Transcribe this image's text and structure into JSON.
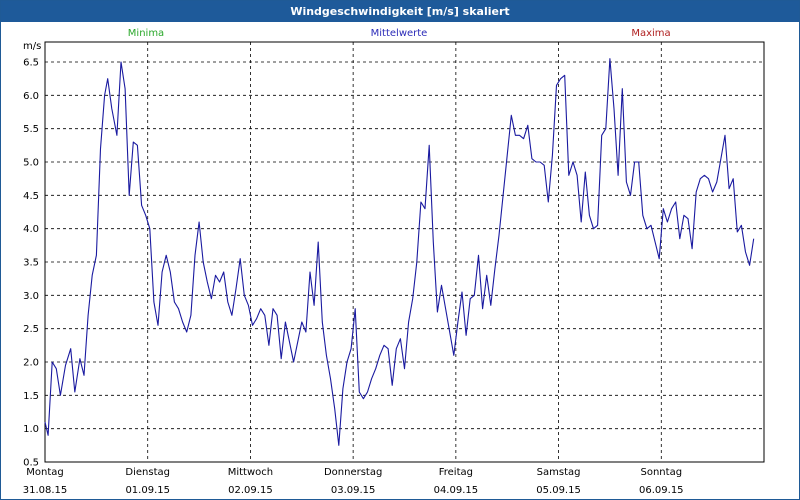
{
  "window": {
    "title": "Windgeschwindigkeit [m/s] skaliert"
  },
  "legend": {
    "min_label": "Minima",
    "mean_label": "Mittelwerte",
    "max_label": "Maxima",
    "min_color": "#2aa82a",
    "mean_color": "#2b2bb8",
    "max_color": "#b02020"
  },
  "chart_data": {
    "type": "line",
    "ylabel": "m/s",
    "ylim": [
      0.5,
      6.8
    ],
    "yticks": [
      "0.5",
      "1.0",
      "1.5",
      "2.0",
      "2.5",
      "3.0",
      "3.5",
      "4.0",
      "4.5",
      "5.0",
      "5.5",
      "6.0",
      "6.5"
    ],
    "xlim": [
      0,
      7
    ],
    "grid": true,
    "x_categories": [
      {
        "day": "Montag",
        "date": "31.08.15"
      },
      {
        "day": "Dienstag",
        "date": "01.09.15"
      },
      {
        "day": "Mittwoch",
        "date": "02.09.15"
      },
      {
        "day": "Donnerstag",
        "date": "03.09.15"
      },
      {
        "day": "Freitag",
        "date": "04.09.15"
      },
      {
        "day": "Samstag",
        "date": "05.09.15"
      },
      {
        "day": "Sonntag",
        "date": "06.09.15"
      }
    ],
    "series": [
      {
        "name": "Mittelwerte",
        "color": "#1a1aa0",
        "points": [
          [
            0.0,
            1.1
          ],
          [
            0.03,
            0.9
          ],
          [
            0.07,
            2.0
          ],
          [
            0.11,
            1.9
          ],
          [
            0.15,
            1.5
          ],
          [
            0.2,
            1.95
          ],
          [
            0.25,
            2.2
          ],
          [
            0.29,
            1.55
          ],
          [
            0.34,
            2.05
          ],
          [
            0.38,
            1.8
          ],
          [
            0.42,
            2.7
          ],
          [
            0.46,
            3.3
          ],
          [
            0.5,
            3.6
          ],
          [
            0.54,
            5.2
          ],
          [
            0.58,
            6.0
          ],
          [
            0.61,
            6.25
          ],
          [
            0.65,
            5.8
          ],
          [
            0.7,
            5.4
          ],
          [
            0.74,
            6.5
          ],
          [
            0.78,
            6.1
          ],
          [
            0.82,
            4.5
          ],
          [
            0.86,
            5.3
          ],
          [
            0.9,
            5.25
          ],
          [
            0.94,
            4.35
          ],
          [
            0.98,
            4.2
          ],
          [
            1.02,
            4.0
          ],
          [
            1.06,
            2.9
          ],
          [
            1.1,
            2.55
          ],
          [
            1.14,
            3.35
          ],
          [
            1.18,
            3.6
          ],
          [
            1.22,
            3.35
          ],
          [
            1.26,
            2.9
          ],
          [
            1.3,
            2.8
          ],
          [
            1.34,
            2.6
          ],
          [
            1.38,
            2.45
          ],
          [
            1.42,
            2.7
          ],
          [
            1.46,
            3.6
          ],
          [
            1.5,
            4.1
          ],
          [
            1.54,
            3.5
          ],
          [
            1.58,
            3.2
          ],
          [
            1.62,
            2.95
          ],
          [
            1.66,
            3.3
          ],
          [
            1.7,
            3.2
          ],
          [
            1.74,
            3.35
          ],
          [
            1.78,
            2.9
          ],
          [
            1.82,
            2.7
          ],
          [
            1.86,
            3.1
          ],
          [
            1.9,
            3.55
          ],
          [
            1.94,
            3.0
          ],
          [
            1.98,
            2.85
          ],
          [
            2.02,
            2.55
          ],
          [
            2.06,
            2.65
          ],
          [
            2.1,
            2.8
          ],
          [
            2.14,
            2.7
          ],
          [
            2.18,
            2.25
          ],
          [
            2.22,
            2.8
          ],
          [
            2.26,
            2.7
          ],
          [
            2.3,
            2.05
          ],
          [
            2.34,
            2.6
          ],
          [
            2.38,
            2.3
          ],
          [
            2.42,
            2.0
          ],
          [
            2.46,
            2.3
          ],
          [
            2.5,
            2.6
          ],
          [
            2.54,
            2.45
          ],
          [
            2.58,
            3.35
          ],
          [
            2.62,
            2.85
          ],
          [
            2.66,
            3.8
          ],
          [
            2.7,
            2.6
          ],
          [
            2.74,
            2.1
          ],
          [
            2.78,
            1.75
          ],
          [
            2.82,
            1.3
          ],
          [
            2.86,
            0.75
          ],
          [
            2.9,
            1.6
          ],
          [
            2.94,
            2.0
          ],
          [
            2.98,
            2.2
          ],
          [
            3.02,
            2.8
          ],
          [
            3.06,
            1.55
          ],
          [
            3.1,
            1.45
          ],
          [
            3.14,
            1.55
          ],
          [
            3.18,
            1.75
          ],
          [
            3.22,
            1.9
          ],
          [
            3.26,
            2.1
          ],
          [
            3.3,
            2.25
          ],
          [
            3.34,
            2.2
          ],
          [
            3.38,
            1.65
          ],
          [
            3.42,
            2.2
          ],
          [
            3.46,
            2.35
          ],
          [
            3.5,
            1.9
          ],
          [
            3.54,
            2.6
          ],
          [
            3.58,
            2.95
          ],
          [
            3.62,
            3.5
          ],
          [
            3.66,
            4.4
          ],
          [
            3.7,
            4.3
          ],
          [
            3.74,
            5.25
          ],
          [
            3.78,
            3.8
          ],
          [
            3.82,
            2.75
          ],
          [
            3.86,
            3.15
          ],
          [
            3.9,
            2.8
          ],
          [
            3.94,
            2.45
          ],
          [
            3.98,
            2.1
          ],
          [
            4.02,
            2.6
          ],
          [
            4.06,
            3.05
          ],
          [
            4.1,
            2.4
          ],
          [
            4.14,
            2.95
          ],
          [
            4.18,
            3.0
          ],
          [
            4.22,
            3.6
          ],
          [
            4.26,
            2.8
          ],
          [
            4.3,
            3.3
          ],
          [
            4.34,
            2.85
          ],
          [
            4.38,
            3.4
          ],
          [
            4.42,
            3.9
          ],
          [
            4.46,
            4.5
          ],
          [
            4.5,
            5.1
          ],
          [
            4.54,
            5.7
          ],
          [
            4.58,
            5.4
          ],
          [
            4.62,
            5.4
          ],
          [
            4.66,
            5.35
          ],
          [
            4.7,
            5.55
          ],
          [
            4.74,
            5.05
          ],
          [
            4.78,
            5.0
          ],
          [
            4.82,
            5.0
          ],
          [
            4.86,
            4.95
          ],
          [
            4.9,
            4.4
          ],
          [
            4.94,
            5.1
          ],
          [
            4.98,
            6.15
          ],
          [
            5.02,
            6.25
          ],
          [
            5.06,
            6.3
          ],
          [
            5.1,
            4.8
          ],
          [
            5.14,
            5.0
          ],
          [
            5.18,
            4.8
          ],
          [
            5.22,
            4.1
          ],
          [
            5.26,
            4.85
          ],
          [
            5.3,
            4.2
          ],
          [
            5.34,
            4.0
          ],
          [
            5.38,
            4.05
          ],
          [
            5.42,
            5.4
          ],
          [
            5.46,
            5.5
          ],
          [
            5.5,
            6.55
          ],
          [
            5.54,
            5.8
          ],
          [
            5.58,
            4.8
          ],
          [
            5.62,
            6.1
          ],
          [
            5.66,
            4.7
          ],
          [
            5.7,
            4.5
          ],
          [
            5.74,
            5.0
          ],
          [
            5.78,
            5.0
          ],
          [
            5.82,
            4.2
          ],
          [
            5.86,
            4.0
          ],
          [
            5.9,
            4.05
          ],
          [
            5.94,
            3.8
          ],
          [
            5.98,
            3.55
          ],
          [
            6.02,
            4.3
          ],
          [
            6.06,
            4.1
          ],
          [
            6.1,
            4.3
          ],
          [
            6.14,
            4.4
          ],
          [
            6.18,
            3.85
          ],
          [
            6.22,
            4.2
          ],
          [
            6.26,
            4.15
          ],
          [
            6.3,
            3.7
          ],
          [
            6.34,
            4.55
          ],
          [
            6.38,
            4.75
          ],
          [
            6.42,
            4.8
          ],
          [
            6.46,
            4.75
          ],
          [
            6.5,
            4.55
          ],
          [
            6.54,
            4.7
          ],
          [
            6.58,
            5.05
          ],
          [
            6.62,
            5.4
          ],
          [
            6.66,
            4.6
          ],
          [
            6.7,
            4.75
          ],
          [
            6.74,
            3.95
          ],
          [
            6.78,
            4.05
          ],
          [
            6.82,
            3.65
          ],
          [
            6.86,
            3.45
          ],
          [
            6.9,
            3.85
          ]
        ]
      }
    ]
  }
}
